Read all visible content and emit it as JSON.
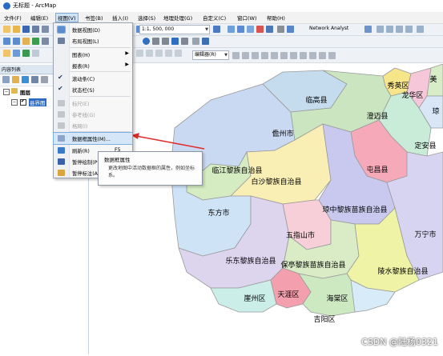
{
  "window": {
    "title": "无标题 - ArcMap"
  },
  "menubar": {
    "items": [
      "文件(F)",
      "编辑(E)",
      "视图(V)",
      "书签(B)",
      "插入(I)",
      "选择(S)",
      "地理处理(G)",
      "自定义(C)",
      "窗口(W)",
      "帮助(H)"
    ]
  },
  "toolbar": {
    "scale": "1:1, 500, 000",
    "network_analyst": "Network Analyst",
    "editor": "编辑器(R)"
  },
  "toc": {
    "title": "内容列表",
    "layers_label": "图层",
    "layer_name": "县界图"
  },
  "view_menu": {
    "items": [
      {
        "label": "数据视图(D)",
        "shortcut": "",
        "icon": "data-view-icon",
        "checked": true,
        "disabled": false,
        "submenu": false
      },
      {
        "label": "布局视图(L)",
        "shortcut": "",
        "icon": "layout-view-icon",
        "checked": false,
        "disabled": false,
        "submenu": false
      },
      {
        "label": "图表(H)",
        "shortcut": "",
        "icon": "",
        "checked": false,
        "disabled": false,
        "submenu": true
      },
      {
        "label": "报表(R)",
        "shortcut": "",
        "icon": "",
        "checked": false,
        "disabled": false,
        "submenu": true
      },
      {
        "label": "滚动条(C)",
        "shortcut": "",
        "icon": "check-icon",
        "checked": true,
        "disabled": false,
        "submenu": false
      },
      {
        "label": "状态栏(S)",
        "shortcut": "",
        "icon": "check-icon",
        "checked": true,
        "disabled": false,
        "submenu": false
      },
      {
        "label": "标尺(E)",
        "shortcut": "",
        "icon": "ruler-icon",
        "checked": false,
        "disabled": true,
        "submenu": false
      },
      {
        "label": "参考线(G)",
        "shortcut": "",
        "icon": "guides-icon",
        "checked": false,
        "disabled": true,
        "submenu": false
      },
      {
        "label": "格网(I)",
        "shortcut": "",
        "icon": "grid-icon",
        "checked": false,
        "disabled": true,
        "submenu": false
      },
      {
        "label": "数据框属性(M)...",
        "shortcut": "",
        "icon": "properties-icon",
        "checked": false,
        "disabled": false,
        "submenu": false,
        "highlighted": true
      },
      {
        "label": "刷新(R)",
        "shortcut": "F5",
        "icon": "refresh-icon",
        "checked": false,
        "disabled": false,
        "submenu": false
      },
      {
        "label": "暂停绘制(P)",
        "shortcut": "",
        "icon": "pause-icon",
        "checked": false,
        "disabled": false,
        "submenu": false
      },
      {
        "label": "暂停标注(A)",
        "shortcut": "",
        "icon": "pause-label-icon",
        "checked": false,
        "disabled": false,
        "submenu": false
      }
    ]
  },
  "tooltip": {
    "title": "数据框属性",
    "body": "更改地图中活动数据框的属性，例如坐标系。"
  },
  "map": {
    "labels": [
      "临高县",
      "秀英区",
      "龙华区",
      "美",
      "琼",
      "儋州市",
      "澄迈县",
      "定安县",
      "临江黎族自治县",
      "白沙黎族自治县",
      "屯昌县",
      "东方市",
      "琼中黎族苗族自治县",
      "五指山市",
      "万宁市",
      "乐东黎族自治县",
      "保亭黎族苗族自治县",
      "陵水黎族自治县",
      "崖州区",
      "天涯区",
      "海棠区",
      "吉阳区"
    ],
    "colors": {
      "lingao": "#c5dcef",
      "xiuying": "#f7e58a",
      "longhua": "#f6c7d9",
      "danzhou": "#c9d9f2",
      "chengmai": "#cbe5c1",
      "dingan": "#c8ecd8",
      "changjiang": "#d5ecc2",
      "baisha": "#f9efb5",
      "tunchang": "#f6a9b9",
      "dongfang": "#cfe3f6",
      "qiongzhong": "#c9c9f0",
      "wuzhishan": "#f6cfd9",
      "wanning": "#d6d4f0",
      "ledong": "#ddd4ee",
      "baoting": "#d9ecc5",
      "lingshui": "#eef3a6",
      "yazhou": "#cbeee9",
      "tianya": "#f49fad",
      "haitang": "#d7ecf8",
      "jiyang": "#cde9c2"
    }
  },
  "watermark": "CSDN @陆杨0321"
}
